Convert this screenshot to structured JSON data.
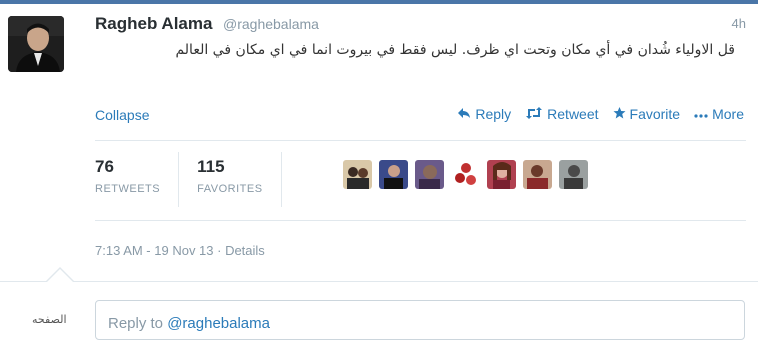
{
  "tweet": {
    "author_name": "Ragheb Alama",
    "author_handle": "@raghebalama",
    "timestamp": "4h",
    "text": "قل الاولياء شُدان في أي مكان وتحت اي ظرف. ليس فقط في بيروت انما في اي مكان في العالم",
    "collapse_label": "Collapse"
  },
  "actions": {
    "reply_label": "Reply",
    "retweet_label": "Retweet",
    "favorite_label": "Favorite",
    "more_label": "More"
  },
  "stats": {
    "retweets_count": "76",
    "retweets_label": "RETWEETS",
    "favorites_count": "115",
    "favorites_label": "FAVORITES"
  },
  "details": {
    "datetime": "7:13 AM - 19 Nov 13 · Details"
  },
  "reply": {
    "prefix": "Reply to ",
    "mention": "@raghebalama",
    "avatar_caption": "الصفحه"
  },
  "colors": {
    "link": "#2b7bb9",
    "muted": "#8899a6",
    "border": "#e1e8ed"
  },
  "icons": [
    "reply-arrow-icon",
    "retweet-icon",
    "star-icon",
    "more-dots-icon"
  ]
}
